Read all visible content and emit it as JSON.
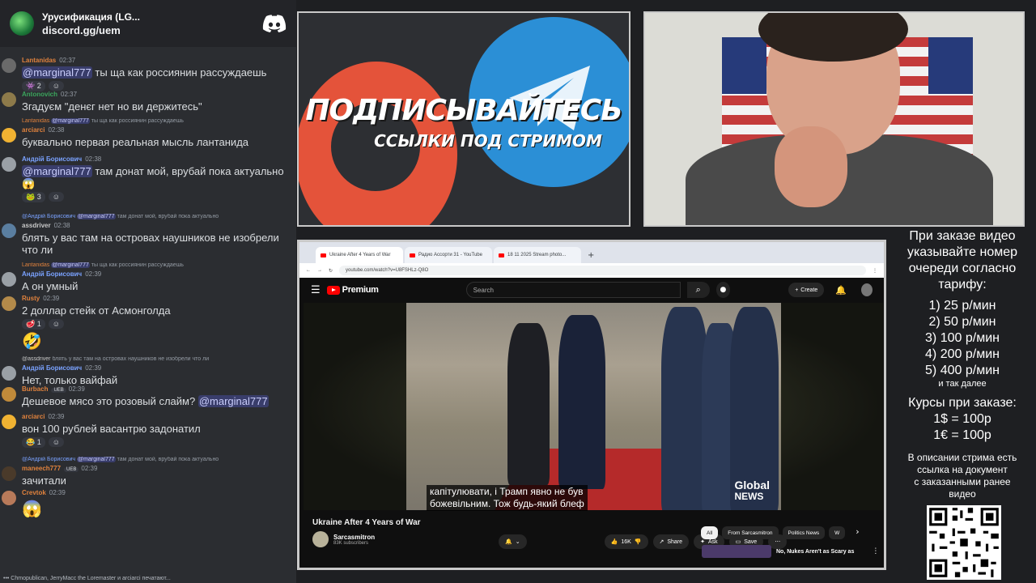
{
  "chat": {
    "server_name": "Урусификация (LG...",
    "invite": "discord.gg/uem",
    "messages": [
      {
        "author": "Lantanidas",
        "author_color": "#e0823d",
        "time": "02:37",
        "text_mention": "@marginal777",
        "text": " ты ща как россиянин рассуждаешь",
        "reaction_count": "2"
      },
      {
        "author": "Antonovich",
        "author_color": "#3ba55d",
        "time": "02:37",
        "text": "Згадуєм \"денєг нет но ви держитесь\""
      },
      {
        "reply_author": "Lantanidas",
        "reply_mention": "@marginal777",
        "reply_text": " ты ща как россиянин рассуждаешь",
        "author": "arciarci",
        "author_color": "#e0823d",
        "time": "02:38",
        "text": "буквально первая реальная мысль лантанида"
      },
      {
        "author": "Андрій Борисович",
        "author_color": "#7aa2ff",
        "time": "02:38",
        "text_mention": "@marginal777",
        "text": " там донат мой, врубай пока актуально",
        "reaction_count": "3"
      },
      {
        "reply_author": "@Андрій Борисович",
        "reply_mention": "@marginal777",
        "reply_text": " там донат мой, врубай пока актуально",
        "author": "assdriver",
        "author_color": "#c8c8c8",
        "time": "02:38",
        "text": "блять у вас там на островах наушников не изобрели что ли"
      },
      {
        "reply_author": "Lantanidas",
        "reply_mention": "@marginal777",
        "reply_text": " ты ща как россиянин рассуждаешь",
        "author": "Андрій Борисович",
        "author_color": "#7aa2ff",
        "time": "02:39",
        "text": "А он умный"
      },
      {
        "author": "Rusty",
        "author_color": "#e0823d",
        "time": "02:39",
        "text": "2 доллар стейк от Асмонголда",
        "reaction_count": "1"
      },
      {
        "reply_author": "@assdriver",
        "reply_text": " блять у вас там на островах наушников не изобрели что ли",
        "author": "Андрій Борисович",
        "author_color": "#7aa2ff",
        "time": "02:39",
        "text": "Нет, только вайфай"
      },
      {
        "author": "Burbach",
        "author_color": "#e0823d",
        "badge": "UEB",
        "time": "02:39",
        "text": "Дешевое мясо это розовый слайм? ",
        "text_mention_after": "@marginal777"
      },
      {
        "author": "arciarci",
        "author_color": "#e0823d",
        "time": "02:39",
        "text": "вон 100 рублей васантрю задонатил",
        "reaction_count": "1"
      },
      {
        "reply_author": "@Андрій Борисович",
        "reply_mention": "@marginal777",
        "reply_text": " там донат мой, врубай пока актуально",
        "author": "maneech777",
        "author_color": "#e0823d",
        "badge": "UEB",
        "time": "02:39",
        "text": "зачитали"
      },
      {
        "author": "Crevtok",
        "author_color": "#e0823d",
        "time": "02:39"
      }
    ],
    "typing": "Chmopublican, JerryMacc the Loremaster и arciarci печатают..."
  },
  "banner": {
    "title": "ПОДПИСЫВАЙТЕСЬ",
    "subtitle": "ССЫЛКИ ПОД СТРИМОМ"
  },
  "browser": {
    "tabs": [
      "Ukraine After 4 Years of War",
      "Радио Ассорти 31 - YouTube",
      "18 11 2025 Stream photo..."
    ],
    "url": "youtube.com/watch?v=U8FSHLz-Q8O",
    "yt_brand": "Premium",
    "search_placeholder": "Search",
    "create_label": "Create",
    "subtitle_line1": "капітулювати, і Трамп явно не був",
    "subtitle_line2": "божевільним.  Тож будь-який блеф",
    "watermark_line1": "Global",
    "watermark_line2": "NEWS",
    "video_title": "Ukraine After 4 Years of War",
    "channel_name": "Sarcasmitron",
    "channel_subs": "83K subscribers",
    "likes": "16K",
    "share_label": "Share",
    "ask_label": "Ask",
    "save_label": "Save",
    "chips": [
      "All",
      "From Sarcasmitron",
      "Politics News",
      "W"
    ],
    "rec_title": "No, Nukes Aren't as Scary as"
  },
  "info": {
    "head": [
      "При заказе видео",
      "указывайте номер",
      "очереди согласно",
      "тарифу:"
    ],
    "prices": [
      "1) 25 р/мин",
      "2) 50 р/мин",
      "3) 100 р/мин",
      "4) 200 р/мин",
      "5) 400 р/мин"
    ],
    "etc": "и так далее",
    "rates_title": "Курсы при заказе:",
    "rates": [
      "1$ = 100р",
      "1€ = 100р"
    ],
    "desc": [
      "В описании стрима есть",
      "ссылка на документ",
      "с заказанными ранее",
      "видео"
    ]
  },
  "colors": {
    "discord_bg": "#2b2d31",
    "mention_bg": "#3c4270",
    "yt_red": "#ff0000"
  }
}
